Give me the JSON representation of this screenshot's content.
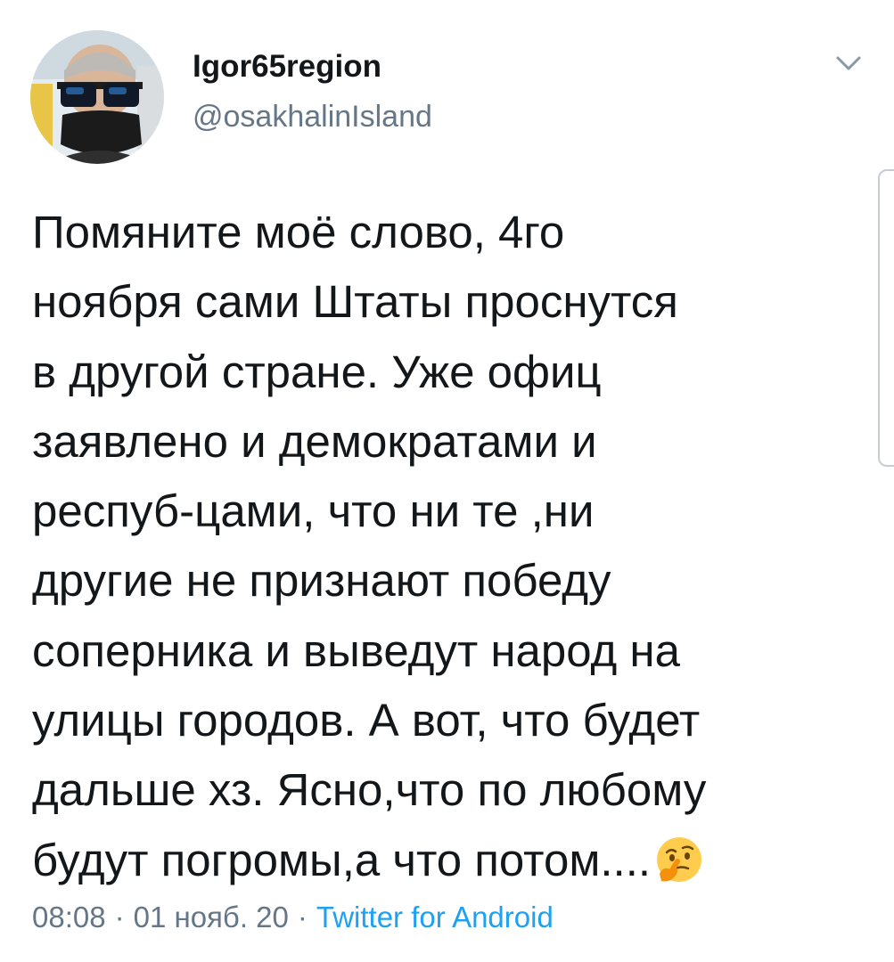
{
  "author": {
    "display_name": "Igor65region",
    "handle": "@osakhalinIsland"
  },
  "tweet": {
    "lines": [
      "Помяните моё слово, 4го",
      "ноября сами Штаты проснутся",
      "в другой стране. Уже офиц",
      "заявлено и демократами и",
      "респуб-цами, что ни те ,ни",
      "другие не признают победу",
      "соперника и выведут народ на",
      "улицы городов. А вот, что будет",
      "дальше хз. Ясно,что по любому",
      "будут погромы,а что потом...."
    ],
    "emoji": "thinking-face"
  },
  "meta": {
    "time": "08:08",
    "date": "01 нояб. 20",
    "separator": "·",
    "source": "Twitter for Android"
  },
  "colors": {
    "text": "#14171a",
    "secondary": "#657786",
    "link": "#1da1f2"
  },
  "icons": {
    "menu": "chevron-down-icon",
    "avatar": "user-avatar"
  }
}
